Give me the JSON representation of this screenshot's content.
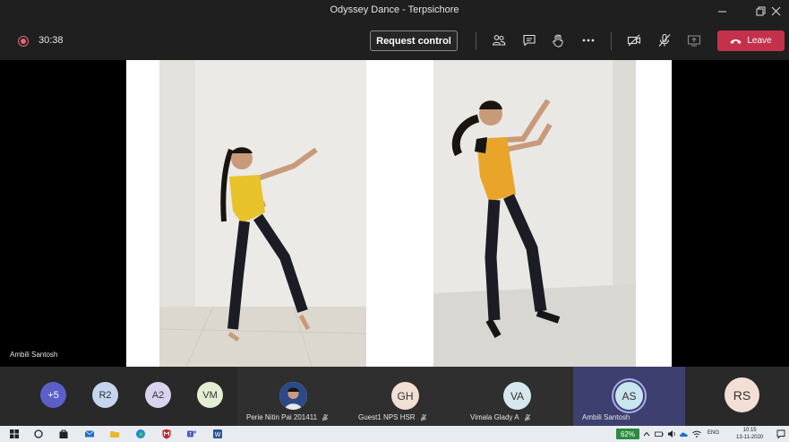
{
  "window": {
    "title": "Odyssey Dance - Terpsichore"
  },
  "toolbar": {
    "timer": "30:38",
    "request_control_label": "Request control",
    "leave_label": "Leave",
    "icons": [
      "participants-icon",
      "chat-icon",
      "raise-hand-icon",
      "more-options-icon",
      "camera-off-icon",
      "mic-off-icon",
      "share-screen-icon"
    ],
    "leave_color": "#c4314b"
  },
  "stage": {
    "presenter_name": "Ambili Santosh"
  },
  "participants": {
    "overflow": "+5",
    "small": [
      {
        "initials": "R2",
        "color": "#c5d5ef"
      },
      {
        "initials": "A2",
        "color": "#d9d3ef"
      },
      {
        "initials": "VM",
        "color": "#e4eed2"
      }
    ],
    "tiles": [
      {
        "initials": "",
        "name": "Perie Nitin Pai 201411",
        "has_photo": true
      },
      {
        "initials": "GH",
        "name": "Guest1 NPS HSR",
        "color": "#f1dfd3"
      },
      {
        "initials": "VA",
        "name": "Vimala Glady A",
        "color": "#d6e7ee"
      },
      {
        "initials": "AS",
        "name": "Ambili Santosh",
        "color": "#c9e5ee",
        "speaking": true
      },
      {
        "initials": "RS",
        "name": "",
        "color": "#f3dfd5"
      }
    ]
  },
  "taskbar": {
    "battery": "62%",
    "language": "ENG",
    "time": "10:15",
    "date": "13-11-2020"
  }
}
